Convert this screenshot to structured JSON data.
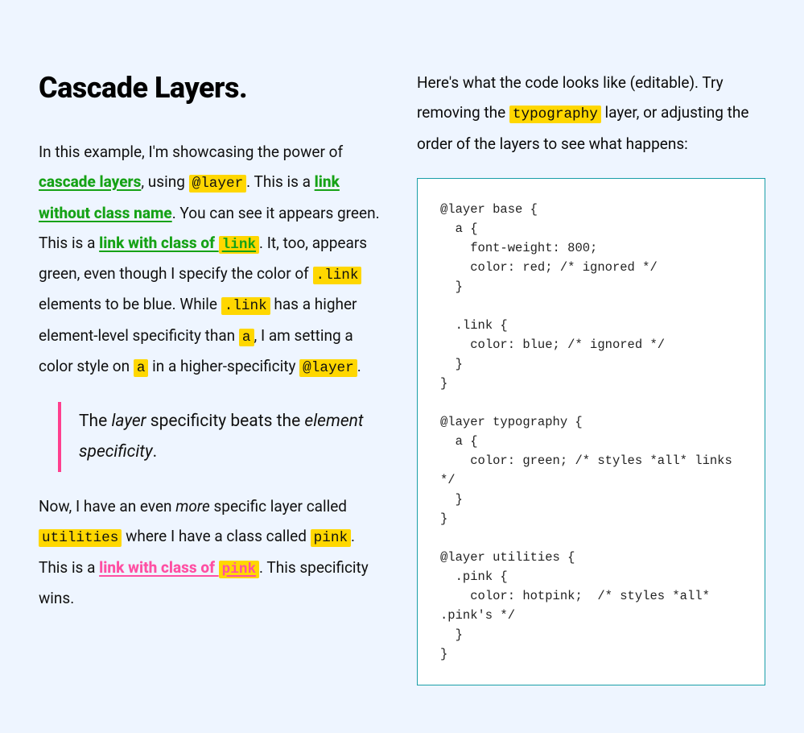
{
  "heading": "Cascade Layers.",
  "left": {
    "p1_a": "In this example, I'm showcasing the power of ",
    "p1_link1": "cascade layers",
    "p1_b": ", using ",
    "p1_code1": "@layer",
    "p1_c": ". This is a ",
    "p1_link2": "link without class name",
    "p1_d": ". You can see it appears green. This is a ",
    "p1_link3_a": "link with class of ",
    "p1_link3_code": "link",
    "p1_e": ". It, too, appears green, even though I specify the color of ",
    "p1_code2": ".link",
    "p1_f": " elements to be blue. While ",
    "p1_code3": ".link",
    "p1_g": " has a higher element-level specificity than ",
    "p1_code4": "a",
    "p1_h": ", I am setting a color style on ",
    "p1_code5": "a",
    "p1_i": " in a higher-specificity ",
    "p1_code6": "@layer",
    "p1_j": ".",
    "bq_a": "The ",
    "bq_em1": "layer",
    "bq_b": " specificity beats the ",
    "bq_em2": "element specificity",
    "bq_c": ".",
    "p2_a": "Now, I have an even ",
    "p2_em": "more",
    "p2_b": " specific layer called ",
    "p2_code1": "utilities",
    "p2_c": " where I have a class called ",
    "p2_code2": "pink",
    "p2_d": ". This is a ",
    "p2_link_a": "link with class of ",
    "p2_link_code": "pink",
    "p2_e": ". This specificity wins."
  },
  "right": {
    "intro_a": "Here's what the code looks like (editable). Try removing the ",
    "intro_code": "typography",
    "intro_b": " layer, or adjusting the order of the layers to see what happens:",
    "code": "@layer base {\n  a {\n    font-weight: 800;\n    color: red; /* ignored */\n  }\n\n  .link {\n    color: blue; /* ignored */\n  }\n}\n\n@layer typography {\n  a {\n    color: green; /* styles *all* links */\n  }\n}\n\n@layer utilities {\n  .pink {\n    color: hotpink;  /* styles *all* .pink's */\n  }\n}"
  }
}
